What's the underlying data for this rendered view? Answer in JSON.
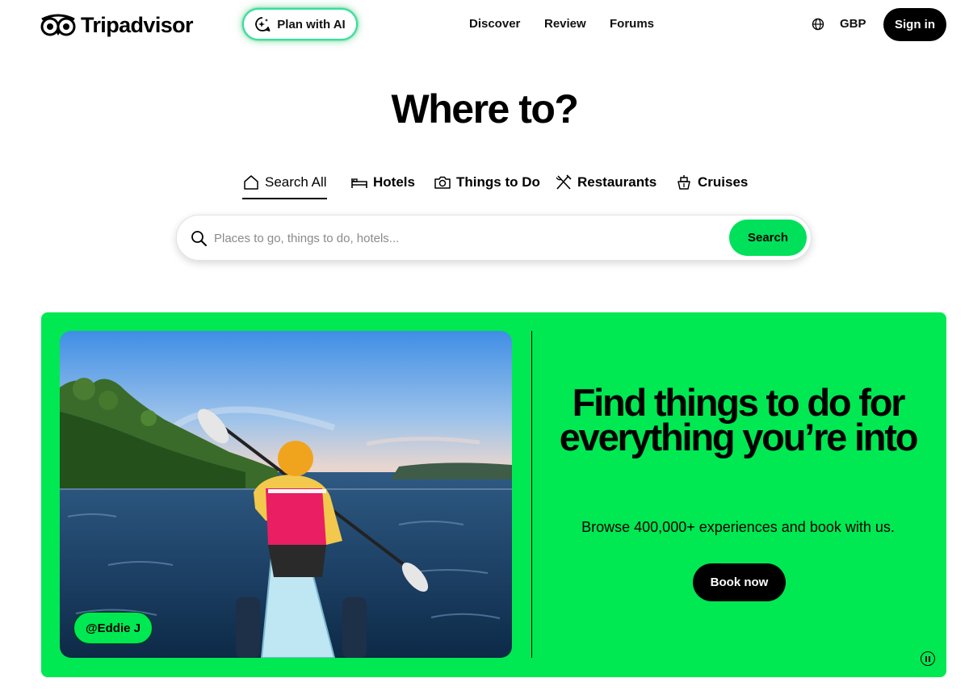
{
  "header": {
    "brand": "Tripadvisor",
    "plan_ai_label": "Plan with AI",
    "nav": [
      "Discover",
      "Review",
      "Forums"
    ],
    "currency": "GBP",
    "signin_label": "Sign in"
  },
  "hero": {
    "title": "Where to?",
    "tabs": [
      {
        "label": "Search All",
        "icon": "home-icon",
        "active": true
      },
      {
        "label": "Hotels",
        "icon": "bed-icon",
        "active": false
      },
      {
        "label": "Things to Do",
        "icon": "camera-icon",
        "active": false
      },
      {
        "label": "Restaurants",
        "icon": "fork-knife-icon",
        "active": false
      },
      {
        "label": "Cruises",
        "icon": "ship-icon",
        "active": false
      }
    ],
    "search": {
      "placeholder": "Places to go, things to do, hotels...",
      "value": "",
      "button_label": "Search"
    }
  },
  "promo": {
    "headline": "Find things to do for everything you’re into",
    "subtext": "Browse 400,000+ experiences and book with us.",
    "button_label": "Book now",
    "photo_credit": "@Eddie J"
  },
  "colors": {
    "brand_green": "#00e852",
    "button_green": "#00e05a",
    "ai_glow": "#34e0a1",
    "dark": "#000000"
  }
}
